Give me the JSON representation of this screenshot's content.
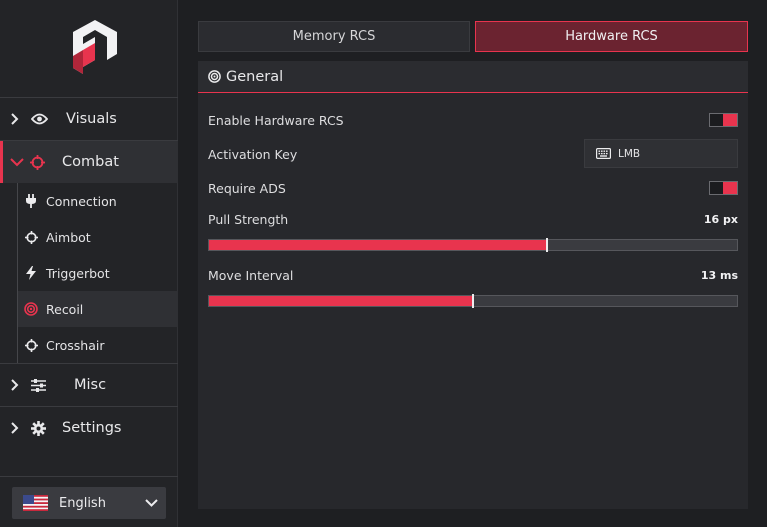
{
  "sidebar": {
    "categories": {
      "visuals": {
        "label": "Visuals",
        "icon": "eye-icon"
      },
      "combat": {
        "label": "Combat",
        "icon": "crosshair-icon"
      },
      "misc": {
        "label": "Misc",
        "icon": "sliders-icon"
      },
      "settings": {
        "label": "Settings",
        "icon": "gear-icon"
      }
    },
    "combat_items": [
      {
        "label": "Connection",
        "icon": "plug-icon"
      },
      {
        "label": "Aimbot",
        "icon": "crosshair-icon"
      },
      {
        "label": "Triggerbot",
        "icon": "bolt-icon"
      },
      {
        "label": "Recoil",
        "icon": "target-icon"
      },
      {
        "label": "Crosshair",
        "icon": "crosshair-icon"
      }
    ],
    "active_item": "Recoil",
    "language": {
      "label": "English",
      "flag": "us-flag-icon"
    }
  },
  "tabs": {
    "memory": "Memory RCS",
    "hardware": "Hardware RCS",
    "active": "Hardware RCS"
  },
  "panel": {
    "title": "General",
    "enable_label": "Enable Hardware RCS",
    "enable_on": true,
    "activation_label": "Activation Key",
    "activation_key": "LMB",
    "ads_label": "Require ADS",
    "ads_on": true,
    "pull": {
      "label": "Pull Strength",
      "value_text": "16 px",
      "fraction": 0.64
    },
    "interval": {
      "label": "Move Interval",
      "value_text": "13 ms",
      "fraction": 0.5
    }
  },
  "colors": {
    "accent": "#e8344e",
    "accent_dark": "#6b2330",
    "background": "#1e1f22",
    "sidebar": "#232427",
    "panel": "#27282c"
  }
}
